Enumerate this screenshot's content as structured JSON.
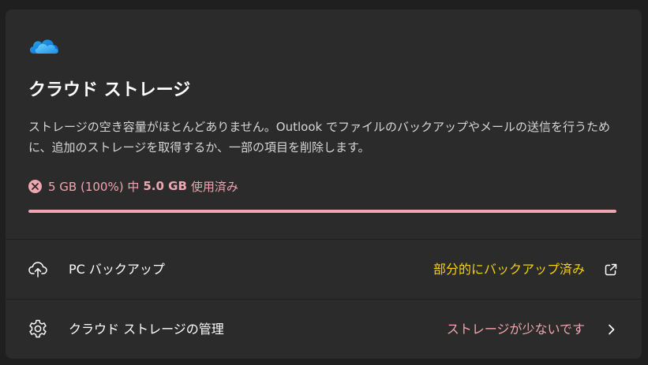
{
  "card": {
    "logo_icon": "onedrive-cloud-icon",
    "title": "クラウド ストレージ",
    "description": "ストレージの空き容量がほとんどありません。Outlook でファイルのバックアップやメールの送信を行うために、追加のストレージを取得するか、一部の項目を削除します。",
    "usage": {
      "icon": "error-circle-icon",
      "prefix": "5 GB (100%) 中",
      "used": "5.0 GB",
      "suffix": "使用済み",
      "fraction": 1.0,
      "color": "#f0a6b0"
    }
  },
  "rows": [
    {
      "icon": "cloud-upload-icon",
      "label": "PC バックアップ",
      "status": "部分的にバックアップ済み",
      "status_color": "#f5d20a",
      "action_icon": "open-external-icon"
    },
    {
      "icon": "gear-icon",
      "label": "クラウド ストレージの管理",
      "status": "ストレージが少ないです",
      "status_color": "#f0a6b0",
      "action_icon": "chevron-right-icon"
    }
  ]
}
